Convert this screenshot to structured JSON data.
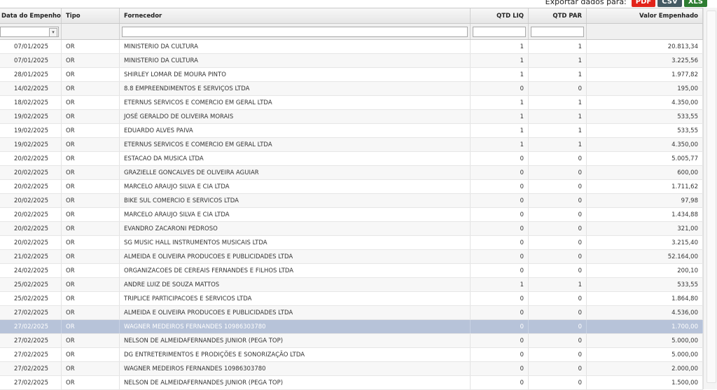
{
  "export": {
    "label": "Exportar dados para:",
    "pdf": "PDF",
    "csv": "CSV",
    "xls": "XLS"
  },
  "columns": {
    "date": "Data do Empenho",
    "tipo": "Tipo",
    "fornecedor": "Fornecedor",
    "qtd_liq": "QTD LIQ",
    "qtd_par": "QTD PAR",
    "valor": "Valor Empenhado"
  },
  "filters": {
    "date_selected": "",
    "fornecedor": "",
    "qtd_liq": "",
    "qtd_par": ""
  },
  "selected_row_index": 21,
  "rows": [
    {
      "date": "07/01/2025",
      "tipo": "OR",
      "fornecedor": "MINISTERIO DA CULTURA",
      "liq": "1",
      "par": "1",
      "valor": "20.813,34"
    },
    {
      "date": "07/01/2025",
      "tipo": "OR",
      "fornecedor": "MINISTERIO DA CULTURA",
      "liq": "1",
      "par": "1",
      "valor": "3.225,56"
    },
    {
      "date": "28/01/2025",
      "tipo": "OR",
      "fornecedor": "SHIRLEY LOMAR DE MOURA PINTO",
      "liq": "1",
      "par": "1",
      "valor": "1.977,82"
    },
    {
      "date": "14/02/2025",
      "tipo": "OR",
      "fornecedor": "8.8 EMPREENDIMENTOS E SERVIÇOS LTDA",
      "liq": "0",
      "par": "0",
      "valor": "195,00"
    },
    {
      "date": "18/02/2025",
      "tipo": "OR",
      "fornecedor": "ETERNUS SERVICOS E COMERCIO EM GERAL LTDA",
      "liq": "1",
      "par": "1",
      "valor": "4.350,00"
    },
    {
      "date": "19/02/2025",
      "tipo": "OR",
      "fornecedor": "JOSÉ GERALDO DE OLIVEIRA MORAIS",
      "liq": "1",
      "par": "1",
      "valor": "533,55"
    },
    {
      "date": "19/02/2025",
      "tipo": "OR",
      "fornecedor": "EDUARDO ALVES PAIVA",
      "liq": "1",
      "par": "1",
      "valor": "533,55"
    },
    {
      "date": "19/02/2025",
      "tipo": "OR",
      "fornecedor": "ETERNUS SERVICOS E COMERCIO EM GERAL LTDA",
      "liq": "1",
      "par": "1",
      "valor": "4.350,00"
    },
    {
      "date": "20/02/2025",
      "tipo": "OR",
      "fornecedor": "ESTACAO DA MUSICA LTDA",
      "liq": "0",
      "par": "0",
      "valor": "5.005,77"
    },
    {
      "date": "20/02/2025",
      "tipo": "OR",
      "fornecedor": "GRAZIELLE GONCALVES DE OLIVEIRA AGUIAR",
      "liq": "0",
      "par": "0",
      "valor": "600,00"
    },
    {
      "date": "20/02/2025",
      "tipo": "OR",
      "fornecedor": "MARCELO ARAUJO SILVA E CIA LTDA",
      "liq": "0",
      "par": "0",
      "valor": "1.711,62"
    },
    {
      "date": "20/02/2025",
      "tipo": "OR",
      "fornecedor": "BIKE SUL COMERCIO E SERVICOS LTDA",
      "liq": "0",
      "par": "0",
      "valor": "97,98"
    },
    {
      "date": "20/02/2025",
      "tipo": "OR",
      "fornecedor": "MARCELO ARAUJO SILVA E CIA LTDA",
      "liq": "0",
      "par": "0",
      "valor": "1.434,88"
    },
    {
      "date": "20/02/2025",
      "tipo": "OR",
      "fornecedor": "EVANDRO ZACARONI PEDROSO",
      "liq": "0",
      "par": "0",
      "valor": "321,00"
    },
    {
      "date": "20/02/2025",
      "tipo": "OR",
      "fornecedor": "SG MUSIC HALL INSTRUMENTOS MUSICAIS LTDA",
      "liq": "0",
      "par": "0",
      "valor": "3.215,40"
    },
    {
      "date": "21/02/2025",
      "tipo": "OR",
      "fornecedor": "ALMEIDA E OLIVEIRA PRODUCOES E PUBLICIDADES LTDA",
      "liq": "0",
      "par": "0",
      "valor": "52.164,00"
    },
    {
      "date": "24/02/2025",
      "tipo": "OR",
      "fornecedor": "ORGANIZACOES DE CEREAIS FERNANDES E FILHOS LTDA",
      "liq": "0",
      "par": "0",
      "valor": "200,10"
    },
    {
      "date": "25/02/2025",
      "tipo": "OR",
      "fornecedor": "ANDRE LUIZ DE SOUZA MATTOS",
      "liq": "1",
      "par": "1",
      "valor": "533,55"
    },
    {
      "date": "25/02/2025",
      "tipo": "OR",
      "fornecedor": "TRIPLICE PARTICIPACOES E SERVICOS LTDA",
      "liq": "0",
      "par": "0",
      "valor": "1.864,80"
    },
    {
      "date": "27/02/2025",
      "tipo": "OR",
      "fornecedor": "ALMEIDA E OLIVEIRA PRODUCOES E PUBLICIDADES LTDA",
      "liq": "0",
      "par": "0",
      "valor": "4.536,00"
    },
    {
      "date": "27/02/2025",
      "tipo": "OR",
      "fornecedor": "WAGNER MEDEIROS FERNANDES 10986303780",
      "liq": "0",
      "par": "0",
      "valor": "1.700,00"
    },
    {
      "date": "27/02/2025",
      "tipo": "OR",
      "fornecedor": "NELSON DE ALMEIDAFERNANDES JUNIOR (PEGA TOP)",
      "liq": "0",
      "par": "0",
      "valor": "5.000,00"
    },
    {
      "date": "27/02/2025",
      "tipo": "OR",
      "fornecedor": "DG ENTRETERIMENTOS E PRODIÇÕES E SONORIZAÇÃO LTDA",
      "liq": "0",
      "par": "0",
      "valor": "5.000,00"
    },
    {
      "date": "27/02/2025",
      "tipo": "OR",
      "fornecedor": "WAGNER MEDEIROS FERNANDES 10986303780",
      "liq": "0",
      "par": "0",
      "valor": "2.000,00"
    },
    {
      "date": "27/02/2025",
      "tipo": "OR",
      "fornecedor": "NELSON DE ALMEIDAFERNANDES JUNIOR (PEGA TOP)",
      "liq": "0",
      "par": "0",
      "valor": "1.500,00"
    }
  ]
}
